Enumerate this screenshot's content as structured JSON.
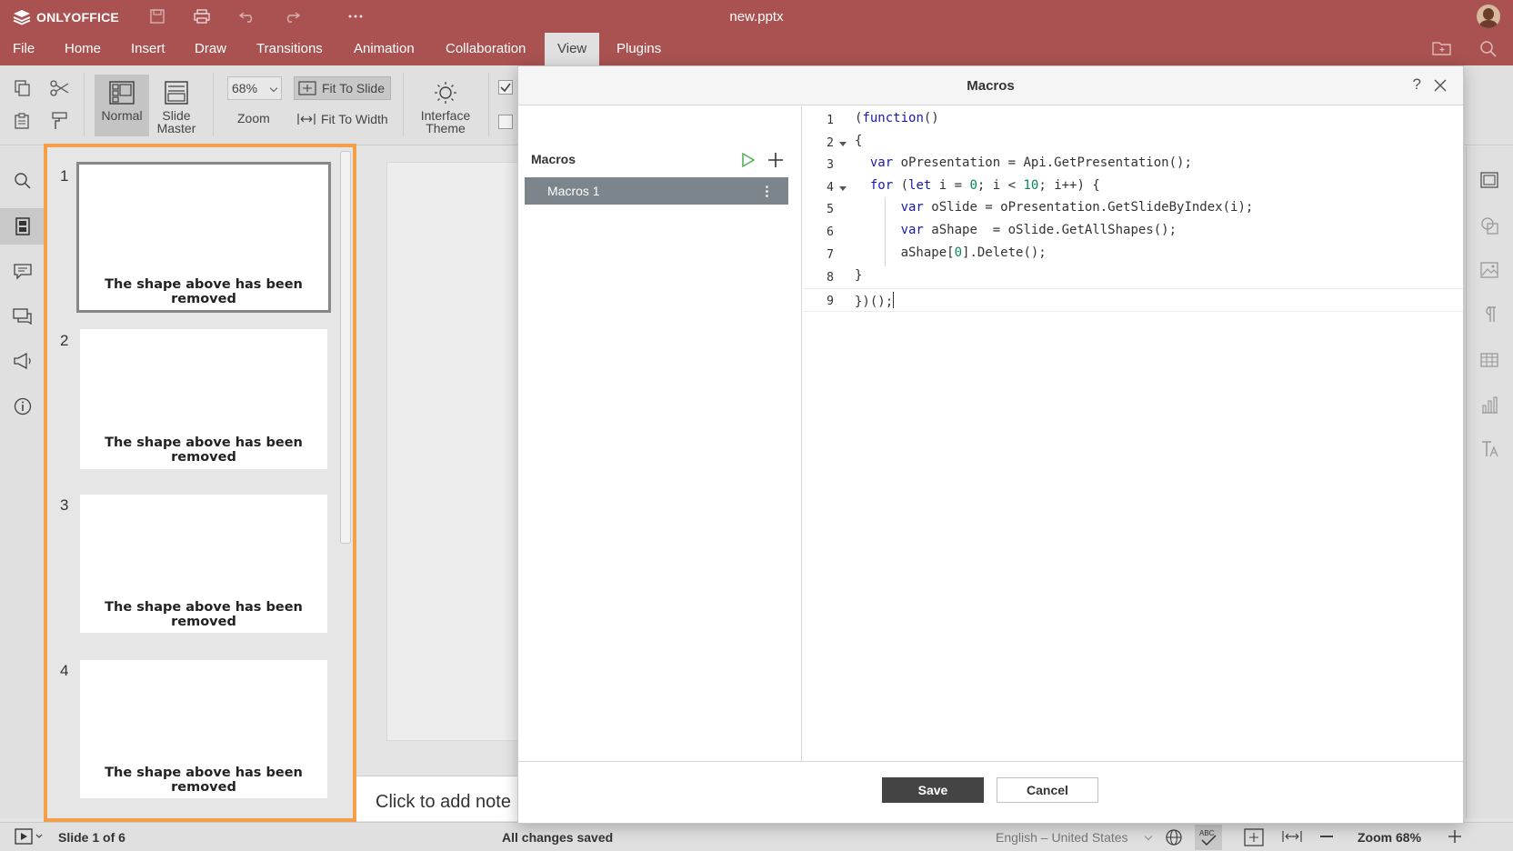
{
  "app": {
    "name": "ONLYOFFICE",
    "document_title": "new.pptx"
  },
  "titlebar": {
    "icons": [
      "save-icon",
      "print-icon",
      "undo-icon",
      "redo-icon",
      "more-icon"
    ]
  },
  "menu": {
    "tabs": [
      {
        "label": "File"
      },
      {
        "label": "Home"
      },
      {
        "label": "Insert"
      },
      {
        "label": "Draw"
      },
      {
        "label": "Transitions"
      },
      {
        "label": "Animation"
      },
      {
        "label": "Collaboration"
      },
      {
        "label": "View"
      },
      {
        "label": "Plugins"
      }
    ],
    "active_tab": "View"
  },
  "toolbar": {
    "normal_label": "Normal",
    "slide_master_label_1": "Slide",
    "slide_master_label_2": "Master",
    "zoom_value": "68%",
    "zoom_label": "Zoom",
    "fit_to_slide_label": "Fit To Slide",
    "fit_to_width_label": "Fit To Width",
    "interface_theme_label_1": "Interface",
    "interface_theme_label_2": "Theme"
  },
  "slides": {
    "items": [
      {
        "number": "1",
        "text": "The shape above has been removed"
      },
      {
        "number": "2",
        "text": "The shape above has been removed"
      },
      {
        "number": "3",
        "text": "The shape above has been removed"
      },
      {
        "number": "4",
        "text": "The shape above has been removed"
      }
    ],
    "notes_placeholder": "Click to add note"
  },
  "dialog": {
    "title": "Macros",
    "help": "?",
    "list_title": "Macros",
    "macros": [
      {
        "name": "Macros 1"
      }
    ],
    "code_lines": [
      {
        "n": "1",
        "text": "(function()"
      },
      {
        "n": "2",
        "text": "{"
      },
      {
        "n": "3",
        "text": "  var oPresentation = Api.GetPresentation();"
      },
      {
        "n": "4",
        "text": "  for (let i = 0; i < 10; i++) {"
      },
      {
        "n": "5",
        "text": "      var oSlide = oPresentation.GetSlideByIndex(i);"
      },
      {
        "n": "6",
        "text": "      var aShape  = oSlide.GetAllShapes();"
      },
      {
        "n": "7",
        "text": "      aShape[0].Delete();"
      },
      {
        "n": "8",
        "text": "}"
      },
      {
        "n": "9",
        "text": "})();"
      }
    ],
    "save_label": "Save",
    "cancel_label": "Cancel"
  },
  "statusbar": {
    "slide_counter": "Slide 1 of 6",
    "save_status": "All changes saved",
    "language": "English – United States",
    "zoom": "Zoom 68%"
  },
  "colors": {
    "header": "#aa5252",
    "thumbnail_highlight": "#f5a049",
    "selected_macro": "#7d858c",
    "run_icon": "#4caf50",
    "keyword": "#1a1aa6",
    "number": "#098658"
  }
}
